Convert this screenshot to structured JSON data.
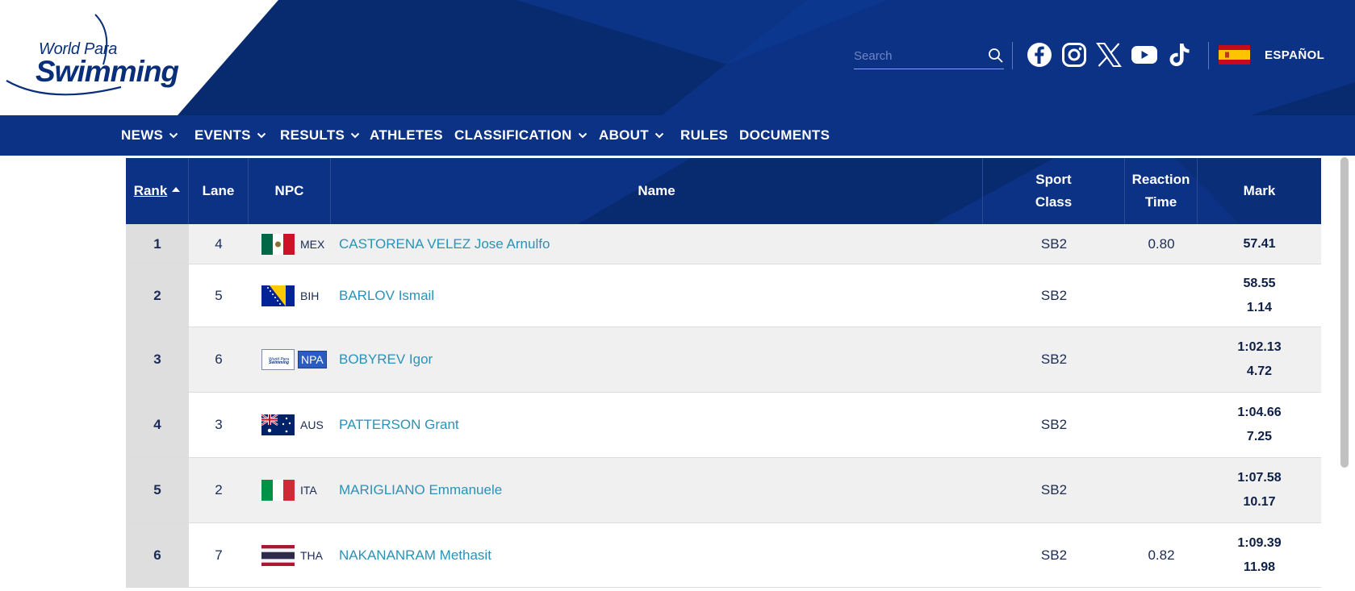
{
  "header": {
    "logo": {
      "line1": "World Para",
      "line2": "Swimming"
    },
    "search": {
      "placeholder": "Search",
      "value": ""
    },
    "social": [
      "facebook-icon",
      "instagram-icon",
      "x-icon",
      "youtube-icon",
      "tiktok-icon"
    ],
    "language": {
      "label": "ESPAÑOL",
      "flag": "spain-flag"
    }
  },
  "nav": {
    "items": [
      {
        "label": "NEWS",
        "dropdown": true
      },
      {
        "label": "EVENTS",
        "dropdown": true
      },
      {
        "label": "RESULTS",
        "dropdown": true
      },
      {
        "label": "ATHLETES",
        "dropdown": false
      },
      {
        "label": "CLASSIFICATION",
        "dropdown": true
      },
      {
        "label": "ABOUT",
        "dropdown": true
      },
      {
        "label": "RULES",
        "dropdown": false
      },
      {
        "label": "DOCUMENTS",
        "dropdown": false
      }
    ]
  },
  "table": {
    "headers": {
      "rank": "Rank",
      "lane": "Lane",
      "npc": "NPC",
      "name": "Name",
      "sport_class_1": "Sport",
      "sport_class_2": "Class",
      "reaction_1": "Reaction",
      "reaction_2": "Time",
      "mark": "Mark"
    },
    "rows": [
      {
        "rank": "1",
        "lane": "4",
        "npc": "MEX",
        "name": "CASTORENA VELEZ Jose Arnulfo",
        "sport_class": "SB2",
        "reaction_time": "0.80",
        "mark": "57.41",
        "behind": ""
      },
      {
        "rank": "2",
        "lane": "5",
        "npc": "BIH",
        "name": "BARLOV Ismail",
        "sport_class": "SB2",
        "reaction_time": "",
        "mark": "58.55",
        "behind": "1.14"
      },
      {
        "rank": "3",
        "lane": "6",
        "npc": "NPA",
        "name": "BOBYREV Igor",
        "sport_class": "SB2",
        "reaction_time": "",
        "mark": "1:02.13",
        "behind": "4.72"
      },
      {
        "rank": "4",
        "lane": "3",
        "npc": "AUS",
        "name": "PATTERSON Grant",
        "sport_class": "SB2",
        "reaction_time": "",
        "mark": "1:04.66",
        "behind": "7.25"
      },
      {
        "rank": "5",
        "lane": "2",
        "npc": "ITA",
        "name": "MARIGLIANO Emmanuele",
        "sport_class": "SB2",
        "reaction_time": "",
        "mark": "1:07.58",
        "behind": "10.17"
      },
      {
        "rank": "6",
        "lane": "7",
        "npc": "THA",
        "name": "NAKANANRAM Methasit",
        "sport_class": "SB2",
        "reaction_time": "0.82",
        "mark": "1:09.39",
        "behind": "11.98"
      }
    ]
  },
  "colors": {
    "primary_navy": "#0b3284",
    "link_blue": "#2a92b8",
    "row_alt": "#f0f0f0"
  }
}
